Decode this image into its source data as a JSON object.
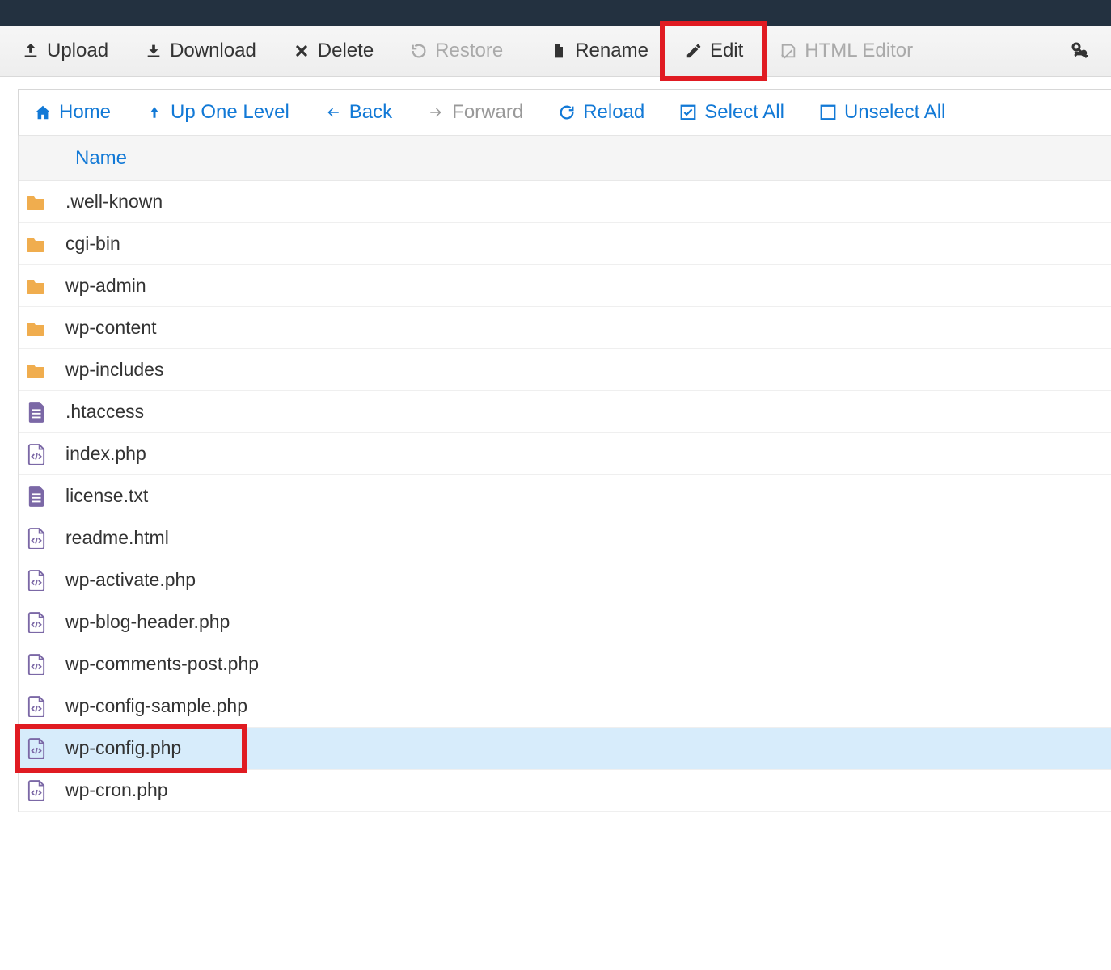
{
  "toolbar": {
    "upload": "Upload",
    "download": "Download",
    "delete": "Delete",
    "restore": "Restore",
    "rename": "Rename",
    "edit": "Edit",
    "html_editor": "HTML Editor"
  },
  "navbar": {
    "home": "Home",
    "up": "Up One Level",
    "back": "Back",
    "forward": "Forward",
    "reload": "Reload",
    "select_all": "Select All",
    "unselect_all": "Unselect All"
  },
  "columns": {
    "name": "Name"
  },
  "files": [
    {
      "name": ".well-known",
      "type": "folder",
      "selected": false
    },
    {
      "name": "cgi-bin",
      "type": "folder",
      "selected": false
    },
    {
      "name": "wp-admin",
      "type": "folder",
      "selected": false
    },
    {
      "name": "wp-content",
      "type": "folder",
      "selected": false
    },
    {
      "name": "wp-includes",
      "type": "folder",
      "selected": false
    },
    {
      "name": ".htaccess",
      "type": "doc",
      "selected": false
    },
    {
      "name": "index.php",
      "type": "code",
      "selected": false
    },
    {
      "name": "license.txt",
      "type": "doc",
      "selected": false
    },
    {
      "name": "readme.html",
      "type": "code",
      "selected": false
    },
    {
      "name": "wp-activate.php",
      "type": "code",
      "selected": false
    },
    {
      "name": "wp-blog-header.php",
      "type": "code",
      "selected": false
    },
    {
      "name": "wp-comments-post.php",
      "type": "code",
      "selected": false
    },
    {
      "name": "wp-config-sample.php",
      "type": "code",
      "selected": false
    },
    {
      "name": "wp-config.php",
      "type": "code",
      "selected": true,
      "highlight": true
    },
    {
      "name": "wp-cron.php",
      "type": "code",
      "selected": false
    }
  ]
}
